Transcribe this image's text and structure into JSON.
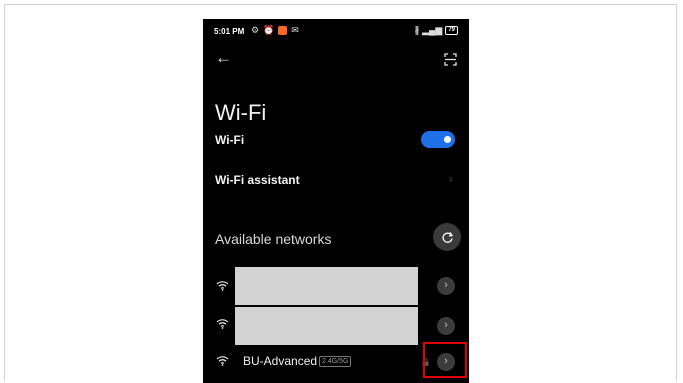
{
  "status_bar": {
    "time": "5:01 PM",
    "battery": "79",
    "signal_glyph": "▂▄▆",
    "bluetooth_glyph": "∦"
  },
  "page": {
    "title": "Wi-Fi"
  },
  "settings": {
    "wifi_label": "Wi-Fi",
    "wifi_enabled": true,
    "wifi_assistant_label": "Wi-Fi assistant"
  },
  "networks": {
    "section_label": "Available networks",
    "items": [
      {
        "name": "",
        "redacted": true,
        "secured": false
      },
      {
        "name": "",
        "redacted": true,
        "secured": false
      },
      {
        "name": "BU-Advanced",
        "band": "2.4G/5G",
        "redacted": false,
        "secured": true
      }
    ]
  },
  "icons": {
    "back": "back-arrow-icon",
    "scan": "scan-qr-icon",
    "refresh": "refresh-icon",
    "wifi": "wifi-icon",
    "lock": "lock-icon",
    "chevron": "chevron-right-icon"
  },
  "colors": {
    "toggle_on": "#1e6fe8",
    "highlight": "#e00000",
    "background": "#000000"
  }
}
